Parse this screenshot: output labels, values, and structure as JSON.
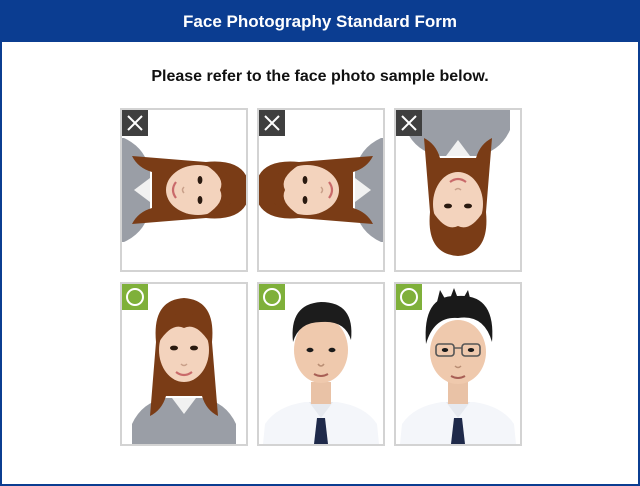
{
  "header": {
    "title": "Face Photography Standard Form"
  },
  "instructions": {
    "text": "Please refer to the face photo sample below."
  },
  "samples": [
    {
      "status": "incorrect",
      "badge_icon": "x-icon",
      "orientation": "rotated-90-clockwise",
      "subject": "woman"
    },
    {
      "status": "incorrect",
      "badge_icon": "x-icon",
      "orientation": "rotated-90-counterclockwise",
      "subject": "woman"
    },
    {
      "status": "incorrect",
      "badge_icon": "x-icon",
      "orientation": "upside-down",
      "subject": "woman"
    },
    {
      "status": "correct",
      "badge_icon": "circle-icon",
      "orientation": "upright",
      "subject": "woman"
    },
    {
      "status": "correct",
      "badge_icon": "circle-icon",
      "orientation": "upright",
      "subject": "man"
    },
    {
      "status": "correct",
      "badge_icon": "circle-icon",
      "orientation": "upright",
      "subject": "man-with-glasses"
    }
  ],
  "colors": {
    "header_bg": "#0b3d91",
    "incorrect_badge": "#3f3f3f",
    "correct_badge": "#7fb03a",
    "card_border": "#d3d3d3"
  }
}
